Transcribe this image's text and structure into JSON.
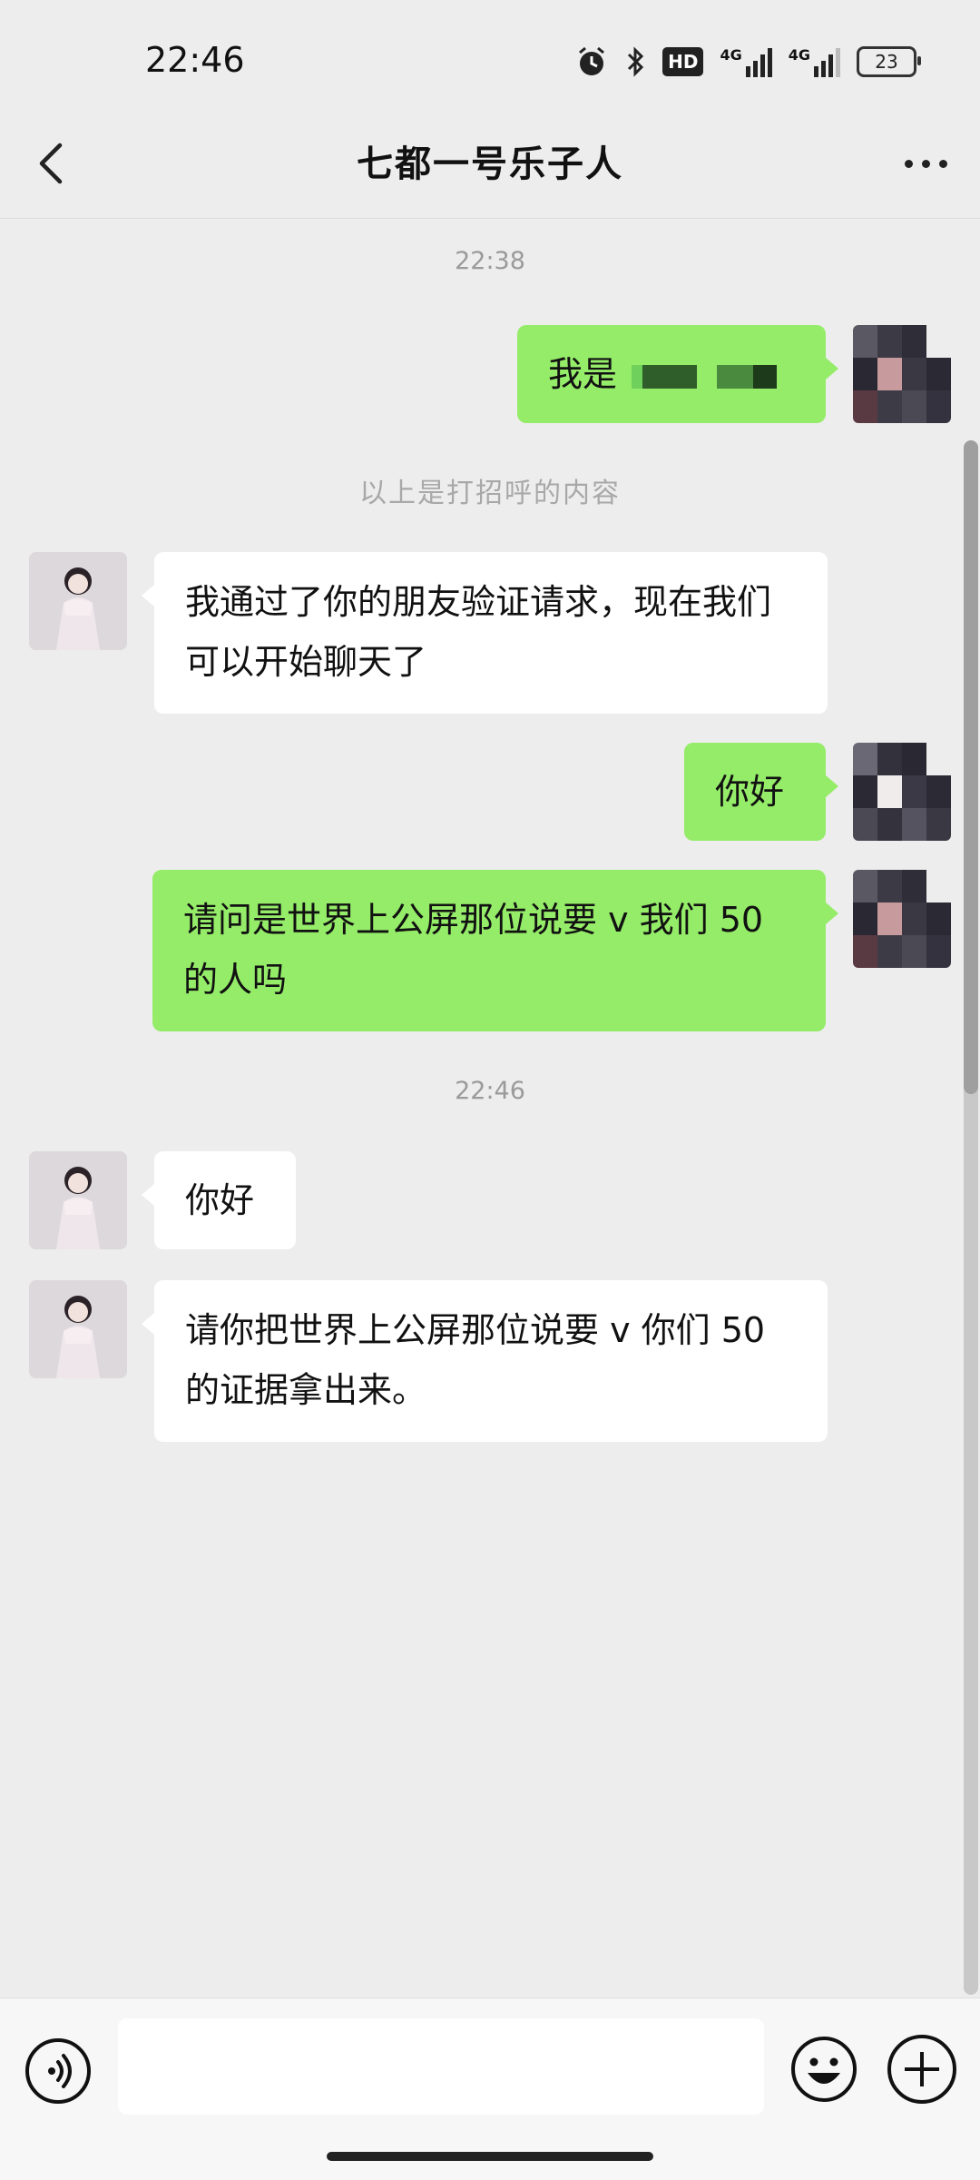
{
  "status_bar": {
    "time": "22:46",
    "hd_label": "HD",
    "signal1_label": "4G",
    "signal2_label": "4G",
    "battery": "23"
  },
  "header": {
    "title": "七都一号乐子人",
    "back_icon": "chevron-left-icon",
    "more_icon": "more-dots-icon"
  },
  "messages": {
    "time1": "22:38",
    "m1": "我是",
    "note": "以上是打招呼的内容",
    "m2": "我通过了你的朋友验证请求，现在我们可以开始聊天了",
    "m3": "你好",
    "m4": "请问是世界上公屏那位说要 v 我们 50 的人吗",
    "time2": "22:46",
    "m5": "你好",
    "m6": "请你把世界上公屏那位说要 v 你们 50 的证据拿出来。"
  },
  "input_bar": {
    "placeholder": "",
    "voice_icon": "voice-icon",
    "emoji_icon": "emoji-icon",
    "plus_icon": "plus-icon"
  },
  "colors": {
    "self_bubble": "#95ec69",
    "other_bubble": "#ffffff",
    "background": "#ededed"
  }
}
